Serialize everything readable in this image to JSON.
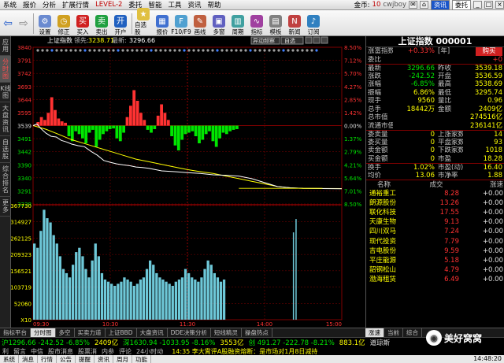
{
  "menubar": {
    "items": [
      "系统",
      "报价",
      "分析",
      "扩展行情"
    ],
    "level": "LEVEL-2",
    "items2": [
      "委托",
      "智能",
      "工具",
      "资讯",
      "帮助"
    ],
    "gold_label": "金币:",
    "gold_value": "10",
    "user": "cwjboy",
    "btn_news": "资讯",
    "btn_trade": "委托"
  },
  "toolbar": {
    "buttons": [
      "设置",
      "修正",
      "买入",
      "卖出",
      "开户"
    ],
    "buttons2": [
      "自选股",
      "报价",
      "F10/F9",
      "画线",
      "多窗",
      "周期",
      "指标",
      "模板",
      "新闻",
      "订阅"
    ]
  },
  "leftbar": {
    "tabs": [
      "应用",
      "分时图",
      "K线图",
      "大盘资讯",
      "自选股",
      "综合排名",
      "更多"
    ]
  },
  "chart": {
    "header_name": "上证指数",
    "header_lead": "领先:",
    "header_lead_val": "3238.71",
    "header_latest": "最新:",
    "header_latest_val": "3296.66",
    "badge1": "异动频察",
    "badge2": "自选",
    "y_price": [
      "3840",
      "3791",
      "3742",
      "3693",
      "3644",
      "3595",
      "3539",
      "3491",
      "3442",
      "3390",
      "3340",
      "3291",
      "3238"
    ],
    "y_pct": [
      "8.50%",
      "7.12%",
      "5.70%",
      "4.27%",
      "2.85%",
      "1.42%",
      "0.00%",
      "1.37%",
      "2.79%",
      "4.21%",
      "5.64%",
      "7.01%",
      "8.50%"
    ],
    "y_vol": [
      "367730",
      "314927",
      "262125",
      "209323",
      "156521",
      "103719",
      "52060",
      "X10"
    ],
    "x_times": [
      "09:30",
      "10:30",
      "11:30",
      "14:00",
      "15:00"
    ],
    "colors": {
      "up": "#ff3232",
      "down": "#00e600",
      "price": "#ffffff",
      "avg": "#ffff00",
      "vol": "#6ec8d8",
      "grid": "#800000"
    }
  },
  "chart_data": {
    "type": "line",
    "xlabel": "",
    "ylabel": "",
    "x_times": [
      "09:30",
      "10:30",
      "11:30",
      "14:00",
      "15:00"
    ],
    "ylim": [
      3238,
      3840
    ],
    "price": {
      "x": [
        0,
        3,
        6,
        10,
        14,
        18,
        22,
        26,
        30,
        35,
        40,
        45,
        50,
        55,
        60,
        65,
        70,
        75,
        80,
        85,
        90,
        95,
        100,
        110,
        120,
        130,
        140,
        150,
        160,
        170,
        180,
        190,
        200,
        210,
        240
      ],
      "y": [
        3539,
        3545,
        3528,
        3510,
        3498,
        3495,
        3482,
        3476,
        3468,
        3462,
        3458,
        3440,
        3425,
        3405,
        3398,
        3392,
        3388,
        3385,
        3380,
        3378,
        3375,
        3370,
        3365,
        3362,
        3358,
        3355,
        3350,
        3348,
        3345,
        3335,
        3320,
        3305,
        3300,
        3298,
        3296
      ]
    },
    "avg": {
      "x": [
        0,
        10,
        20,
        30,
        40,
        50,
        60,
        70,
        80,
        90,
        100,
        110,
        120,
        130,
        140,
        150,
        160,
        170,
        180,
        190,
        200,
        210,
        240
      ],
      "y": [
        3539,
        3525,
        3505,
        3485,
        3470,
        3455,
        3440,
        3425,
        3410,
        3400,
        3390,
        3380,
        3370,
        3362,
        3355,
        3345,
        3335,
        3325,
        3315,
        3305,
        3300,
        3298,
        3297
      ]
    },
    "bars": [
      0,
      5,
      12,
      8,
      18,
      40,
      22,
      10,
      6,
      4,
      -15,
      -22,
      -8,
      -12,
      -18,
      -25,
      -10,
      -6,
      -30,
      -20,
      -12,
      -8,
      -5,
      -4,
      -18,
      -22,
      -10,
      12,
      28,
      50,
      35,
      18,
      8,
      -6,
      -10,
      -5,
      14,
      30,
      18,
      8,
      -15,
      -28,
      -35,
      -20,
      -12,
      -10,
      -8,
      -15,
      -25,
      -20,
      -12,
      -8,
      -22,
      -30,
      -18,
      -10,
      -12,
      -8,
      -6,
      -5
    ],
    "volume": [
      180,
      170,
      210,
      260,
      240,
      230,
      200,
      180,
      150,
      120,
      110,
      100,
      130,
      160,
      170,
      150,
      120,
      100,
      140,
      180,
      150,
      110,
      95,
      90,
      85,
      80,
      85,
      90,
      100,
      95,
      90,
      80,
      85,
      95,
      100,
      120,
      140,
      130,
      110,
      100,
      95,
      90,
      85,
      80,
      90,
      95,
      100,
      120,
      110,
      100,
      95,
      90,
      100,
      120,
      140,
      130,
      110,
      100,
      90,
      95
    ]
  },
  "quote": {
    "title": "上证指数 000001",
    "rows": [
      [
        "涨富指数",
        "+0.33%",
        "[年]",
        "购买"
      ],
      [
        "委比",
        "",
        "",
        "+0"
      ],
      [
        "最新",
        "3296.66",
        "昨收",
        "3539.18"
      ],
      [
        "涨跌",
        "-242.52",
        "开盘",
        "3536.59"
      ],
      [
        "涨幅",
        "-6.85%",
        "最高",
        "3538.69"
      ],
      [
        "振幅",
        "6.86%",
        "最低",
        "3295.74"
      ],
      [
        "现手",
        "9560",
        "量比",
        "0.96"
      ],
      [
        "总手",
        "18442万",
        "金额",
        "2409亿"
      ],
      [
        "总市值",
        "",
        "",
        "274516亿"
      ],
      [
        "流通市值",
        "",
        "",
        "236141亿"
      ],
      [
        "委卖量",
        "0",
        "上涨家数",
        "14"
      ],
      [
        "委买量",
        "0",
        "平盘家数",
        "93"
      ],
      [
        "卖金额",
        "0",
        "下跌家数",
        "1018"
      ],
      [
        "买金额",
        "0",
        "市盈",
        "18.28"
      ],
      [
        "换手",
        "1.02%",
        "市盈(动)",
        "16.40"
      ],
      [
        "均价",
        "13.06",
        "市净率",
        "1.88"
      ]
    ]
  },
  "stocks": {
    "header": [
      "名称",
      "成交",
      "涨速"
    ],
    "rows": [
      [
        "通裕重工",
        "8.28",
        "+0.00"
      ],
      [
        "朗源股份",
        "13.26",
        "+0.00"
      ],
      [
        "联化科技",
        "17.55",
        "+0.00"
      ],
      [
        "天康生物",
        "9.13",
        "+0.00"
      ],
      [
        "四川双马",
        "7.24",
        "+0.00"
      ],
      [
        "现代投资",
        "7.79",
        "+0.00"
      ],
      [
        "吉电股份",
        "9.59",
        "+0.00"
      ],
      [
        "平庄能源",
        "5.18",
        "+0.00"
      ],
      [
        "韶钢松山",
        "4.79",
        "+0.00"
      ],
      [
        "渤海租赁",
        "6.49",
        "+0.00"
      ]
    ]
  },
  "tabs": [
    "指标平台",
    "分时图",
    "多空",
    "买卖力道",
    "上证BBD",
    "大盘资讯",
    "DDE决策分析",
    "短线精灵",
    "操盘热点"
  ],
  "rtabs": [
    "涨速",
    "当前",
    "综合"
  ],
  "status1": {
    "sh": "沪1296.66 -242.52 -6.85%",
    "sh_amt": "2409亿",
    "sz": "深1630.94 -1033.95 -8.16%",
    "sz_amt": "3553亿",
    "cyb": "创 491.27 -222.78 -8.21%",
    "cyb_amt": "883.1亿",
    "dj": "道琼斯"
  },
  "status2": {
    "items": [
      "利",
      "留言",
      "中信",
      "股市消息",
      "股票消",
      "内参",
      "评论",
      "24小时动"
    ],
    "news": "14:35 李大霄评A股融资熔断：是市场对1月8日减持"
  },
  "status3": {
    "items": [
      "系统",
      "消息",
      "行情",
      "公告",
      "提醒",
      "资讯",
      "周月",
      "功能"
    ],
    "time": "14:48:20"
  },
  "watermark": "美好窝窝"
}
